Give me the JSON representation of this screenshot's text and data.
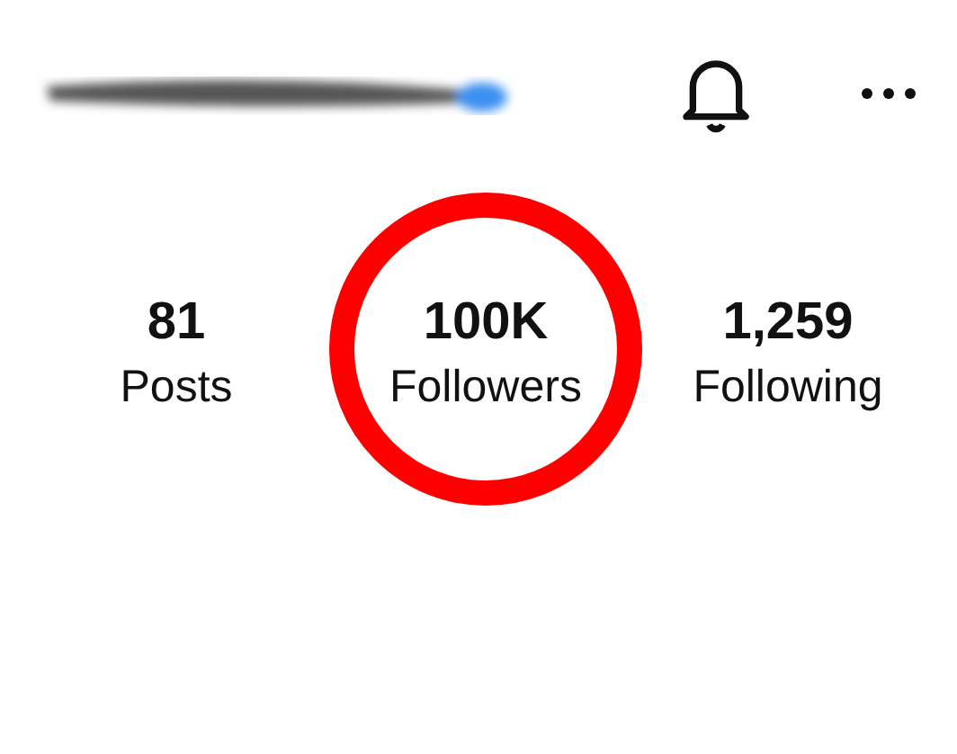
{
  "stats": [
    {
      "value": "81",
      "label": "Posts",
      "circled": false
    },
    {
      "value": "100K",
      "label": "Followers",
      "circled": true
    },
    {
      "value": "1,259",
      "label": "Following",
      "circled": false
    }
  ]
}
